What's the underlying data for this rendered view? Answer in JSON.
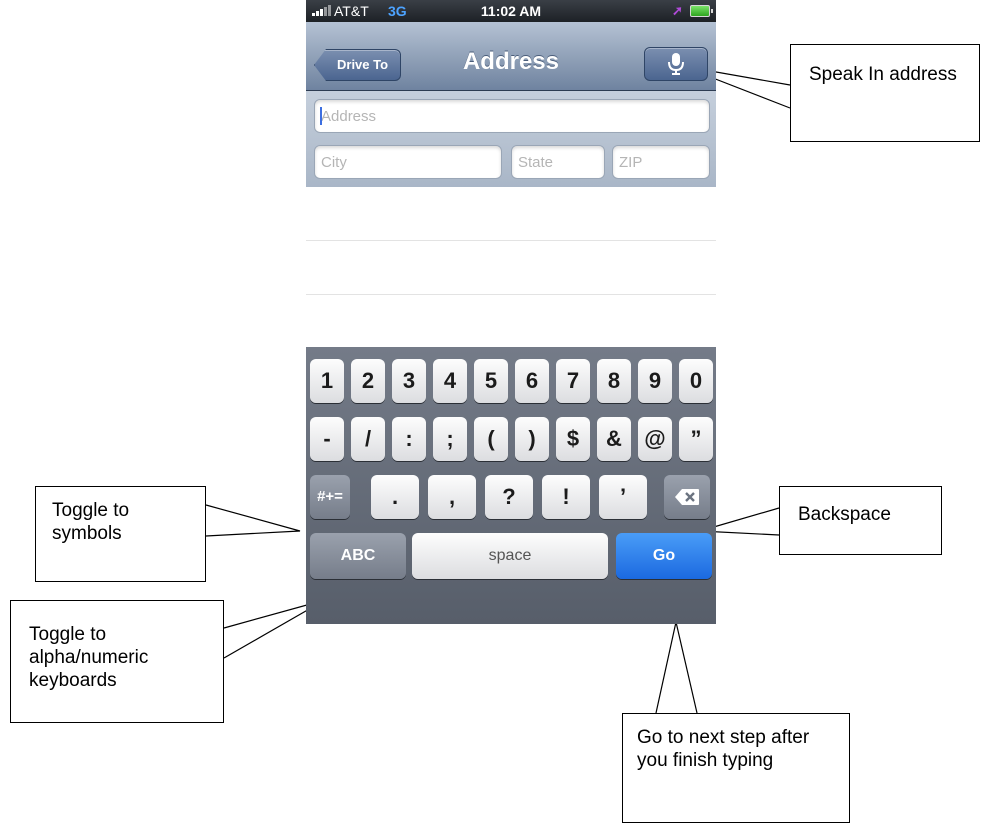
{
  "status_bar": {
    "carrier": "AT&T",
    "network": "3G",
    "time": "11:02 AM"
  },
  "nav": {
    "back_label": "Drive To",
    "title": "Address",
    "mic_icon": "microphone-icon"
  },
  "form": {
    "address_placeholder": "Address",
    "city_placeholder": "City",
    "state_placeholder": "State",
    "zip_placeholder": "ZIP"
  },
  "keyboard": {
    "row1": [
      "1",
      "2",
      "3",
      "4",
      "5",
      "6",
      "7",
      "8",
      "9",
      "0"
    ],
    "row2": [
      "-",
      "/",
      ":",
      ";",
      "(",
      ")",
      "$",
      "&",
      "@",
      "”"
    ],
    "row3": {
      "toggle": "#+=",
      "keys": [
        ".",
        ",",
        "?",
        "!",
        "’"
      ],
      "backspace_icon": "backspace-icon"
    },
    "row4": {
      "abc": "ABC",
      "space": "space",
      "go": "Go"
    },
    "go_color": "#1b69e0"
  },
  "callouts": {
    "speak": "Speak In address",
    "symbols": "Toggle to symbols",
    "backspace": "Backspace",
    "alpha": "Toggle to alpha/numeric keyboards",
    "go": "Go to next step after you finish typing"
  }
}
